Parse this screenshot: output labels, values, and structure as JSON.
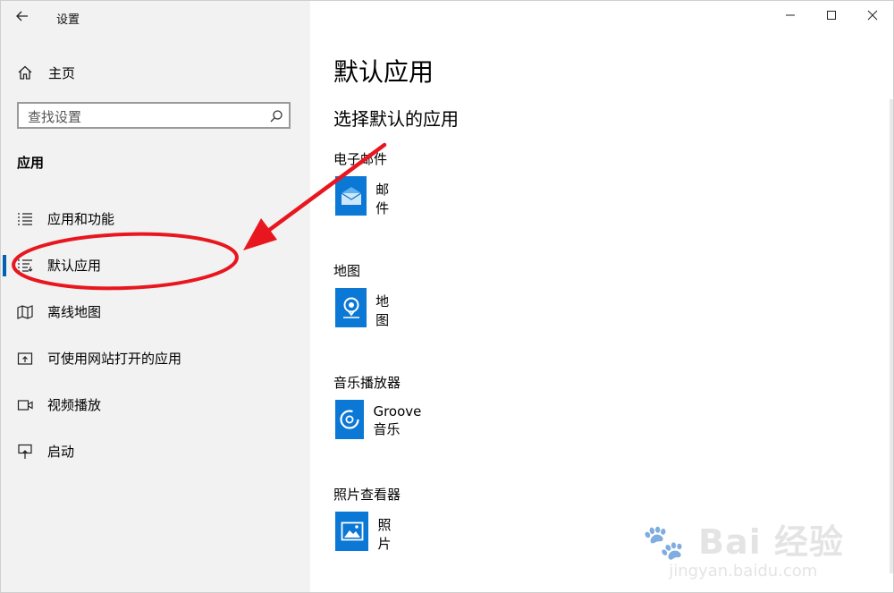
{
  "window": {
    "title": "设置"
  },
  "sidebar": {
    "home_label": "主页",
    "search_placeholder": "查找设置",
    "section_heading": "应用",
    "items": [
      {
        "label": "应用和功能",
        "icon": "apps-list-icon"
      },
      {
        "label": "默认应用",
        "icon": "default-apps-icon",
        "active": true
      },
      {
        "label": "离线地图",
        "icon": "offline-map-icon"
      },
      {
        "label": "可使用网站打开的应用",
        "icon": "open-with-website-icon"
      },
      {
        "label": "视频播放",
        "icon": "video-playback-icon"
      },
      {
        "label": "启动",
        "icon": "startup-icon"
      }
    ]
  },
  "main": {
    "title": "默认应用",
    "subtitle": "选择默认的应用",
    "groups": [
      {
        "category": "电子邮件",
        "app": "邮件",
        "icon": "mail-icon"
      },
      {
        "category": "地图",
        "app": "地图",
        "icon": "maps-icon"
      },
      {
        "category": "音乐播放器",
        "app": "Groove 音乐",
        "icon": "groove-music-icon"
      },
      {
        "category": "照片查看器",
        "app": "照片",
        "icon": "photos-icon"
      }
    ]
  },
  "watermark": {
    "logo_text": "Bai  经验",
    "url": "jingyan.baidu.com"
  },
  "colors": {
    "accent": "#0063b1",
    "tile": "#0a78d4",
    "annotation": "#e8171f",
    "sidebar_bg": "#f2f2f2"
  }
}
